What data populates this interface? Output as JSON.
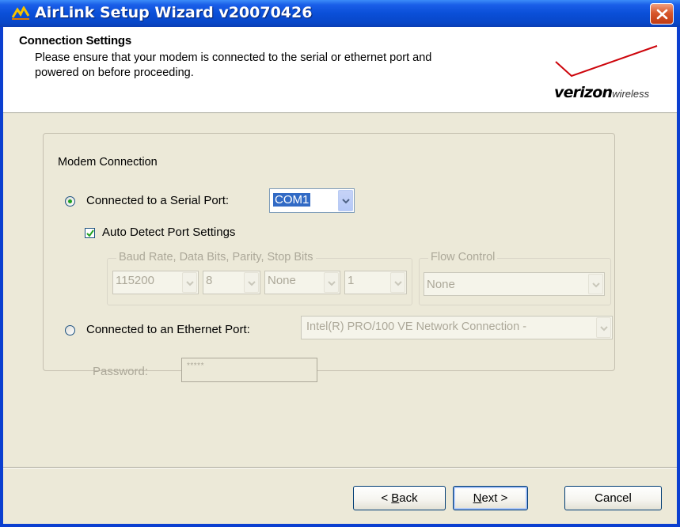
{
  "window": {
    "title": "AirLink Setup Wizard v20070426"
  },
  "header": {
    "title": "Connection Settings",
    "description": "Please ensure that your modem is connected to the serial or ethernet port and powered on before proceeding.",
    "logo": {
      "brand": "verizon",
      "suffix": "wireless",
      "accent_color": "#cd040b"
    }
  },
  "modem_connection": {
    "legend": "Modem Connection",
    "serial": {
      "label": "Connected to a Serial Port:",
      "selected": true,
      "port_value": "COM1",
      "auto_detect": {
        "label": "Auto Detect Port Settings",
        "checked": true
      },
      "port_settings": {
        "legend": "Baud Rate, Data Bits, Parity, Stop Bits",
        "baud_rate": "115200",
        "data_bits": "8",
        "parity": "None",
        "stop_bits": "1"
      },
      "flow_control": {
        "legend": "Flow Control",
        "value": "None"
      }
    },
    "ethernet": {
      "label": "Connected to an Ethernet Port:",
      "selected": false,
      "adapter_value": "Intel(R) PRO/100 VE Network Connection -",
      "password_label": "Password:",
      "password_value": "*****"
    }
  },
  "buttons": {
    "back_prefix": "< ",
    "back_key": "B",
    "back_rest": "ack",
    "next_key": "N",
    "next_rest": "ext >",
    "cancel": "Cancel"
  }
}
